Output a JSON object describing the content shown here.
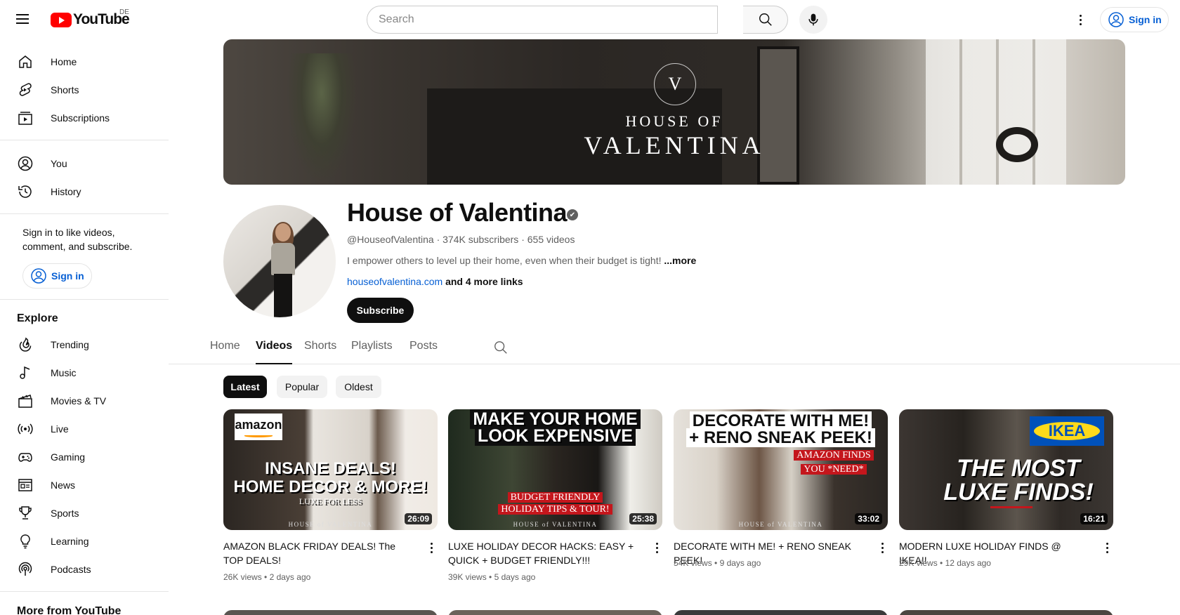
{
  "header": {
    "logo_text": "YouTube",
    "country": "DE",
    "search_placeholder": "Search",
    "signin_label": "Sign in"
  },
  "sidebar": {
    "main": [
      {
        "label": "Home",
        "icon": "home-icon"
      },
      {
        "label": "Shorts",
        "icon": "shorts-icon"
      },
      {
        "label": "Subscriptions",
        "icon": "subscriptions-icon"
      }
    ],
    "you": [
      {
        "label": "You",
        "icon": "you-icon"
      },
      {
        "label": "History",
        "icon": "history-icon"
      }
    ],
    "signin_prompt": "Sign in to like videos, comment, and subscribe.",
    "signin_label": "Sign in",
    "explore_heading": "Explore",
    "explore": [
      {
        "label": "Trending",
        "icon": "trending-icon"
      },
      {
        "label": "Music",
        "icon": "music-icon"
      },
      {
        "label": "Movies & TV",
        "icon": "movies-icon"
      },
      {
        "label": "Live",
        "icon": "live-icon"
      },
      {
        "label": "Gaming",
        "icon": "gaming-icon"
      },
      {
        "label": "News",
        "icon": "news-icon"
      },
      {
        "label": "Sports",
        "icon": "sports-icon"
      },
      {
        "label": "Learning",
        "icon": "learning-icon"
      },
      {
        "label": "Podcasts",
        "icon": "podcasts-icon"
      }
    ],
    "more_heading": "More from YouTube"
  },
  "banner": {
    "monogram": "V",
    "line1": "HOUSE OF",
    "line2": "VALENTINA"
  },
  "channel": {
    "name": "House of Valentina",
    "verified_mark": "✔",
    "meta": "@HouseofValentina · 374K subscribers · 655 videos",
    "description": "I empower others to level up their home, even when their budget is tight! ",
    "more_label": "...more",
    "link": "houseofvalentina.com",
    "more_links": " and 4 more links",
    "subscribe_label": "Subscribe"
  },
  "tabs": [
    "Home",
    "Videos",
    "Shorts",
    "Playlists",
    "Posts"
  ],
  "active_tab": "Videos",
  "chips": [
    "Latest",
    "Popular",
    "Oldest"
  ],
  "active_chip": "Latest",
  "videos": [
    {
      "title": "AMAZON BLACK FRIDAY DEALS! The TOP DEALS!",
      "views": "26K views",
      "age": "2 days ago",
      "duration": "26:09",
      "thumb_badge": "amazon",
      "thumb_line1": "INSANE DEALS!",
      "thumb_line2": "HOME DECOR & MORE!",
      "thumb_sub": "LUXE FOR LESS",
      "thumb_watermark": "HOUSE of VALENTINA"
    },
    {
      "title": "LUXE HOLIDAY DECOR HACKS: EASY + QUICK + BUDGET FRIENDLY!!!",
      "views": "39K views",
      "age": "5 days ago",
      "duration": "25:38",
      "thumb_line1": "MAKE YOUR HOME",
      "thumb_line2": "LOOK EXPENSIVE",
      "thumb_red1": "BUDGET FRIENDLY",
      "thumb_red2": "HOLIDAY TIPS & TOUR!",
      "thumb_watermark": "HOUSE of VALENTINA"
    },
    {
      "title": "DECORATE WITH ME! + RENO SNEAK PEEK!",
      "views": "54K views",
      "age": "9 days ago",
      "duration": "33:02",
      "thumb_line1": "DECORATE WITH ME!",
      "thumb_line2": "+ RENO SNEAK PEEK!",
      "thumb_red1": "AMAZON FINDS",
      "thumb_red2": "YOU *NEED*",
      "thumb_watermark": "HOUSE of VALENTINA"
    },
    {
      "title": "MODERN LUXE HOLIDAY FINDS @ IKEA!!",
      "views": "29K views",
      "age": "12 days ago",
      "duration": "16:21",
      "thumb_badge": "IKEA",
      "thumb_line1": "THE MOST",
      "thumb_line2": "LUXE FINDS!"
    }
  ],
  "colors": {
    "accent_link": "#065fd4",
    "brand_red": "#ff0000",
    "text_primary": "#0f0f0f",
    "text_secondary": "#606060"
  }
}
